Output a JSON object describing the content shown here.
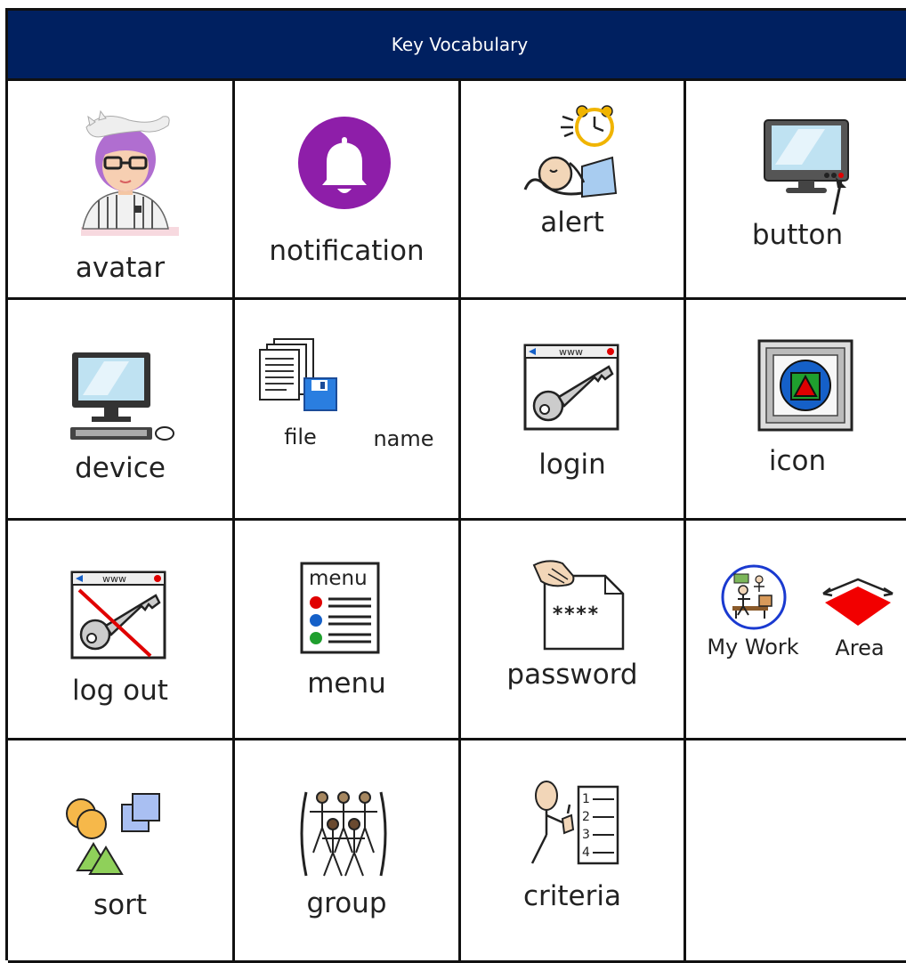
{
  "header": {
    "title": "Key Vocabulary"
  },
  "cells": [
    {
      "label": "avatar"
    },
    {
      "label": "notification"
    },
    {
      "label": "alert"
    },
    {
      "label": "button"
    },
    {
      "label": "device"
    },
    {
      "label_a": "file",
      "label_b": "name"
    },
    {
      "label": "login"
    },
    {
      "label": "icon"
    },
    {
      "label": "log out"
    },
    {
      "label": "menu",
      "icon_text": "menu"
    },
    {
      "label": "password",
      "icon_text": "****"
    },
    {
      "label_a": "My Work",
      "label_b": "Area"
    },
    {
      "label": "sort"
    },
    {
      "label": "group"
    },
    {
      "label": "criteria",
      "icon_text": [
        "1",
        "2",
        "3",
        "4"
      ]
    },
    {
      "label": ""
    }
  ],
  "icons": {
    "www": "www"
  },
  "colors": {
    "header_bg": "#002060",
    "header_text": "#ffffff",
    "notification_purple": "#8e1ea9",
    "icon_red": "#e00000",
    "icon_blue": "#1560c8",
    "icon_green": "#1f9f2e"
  }
}
